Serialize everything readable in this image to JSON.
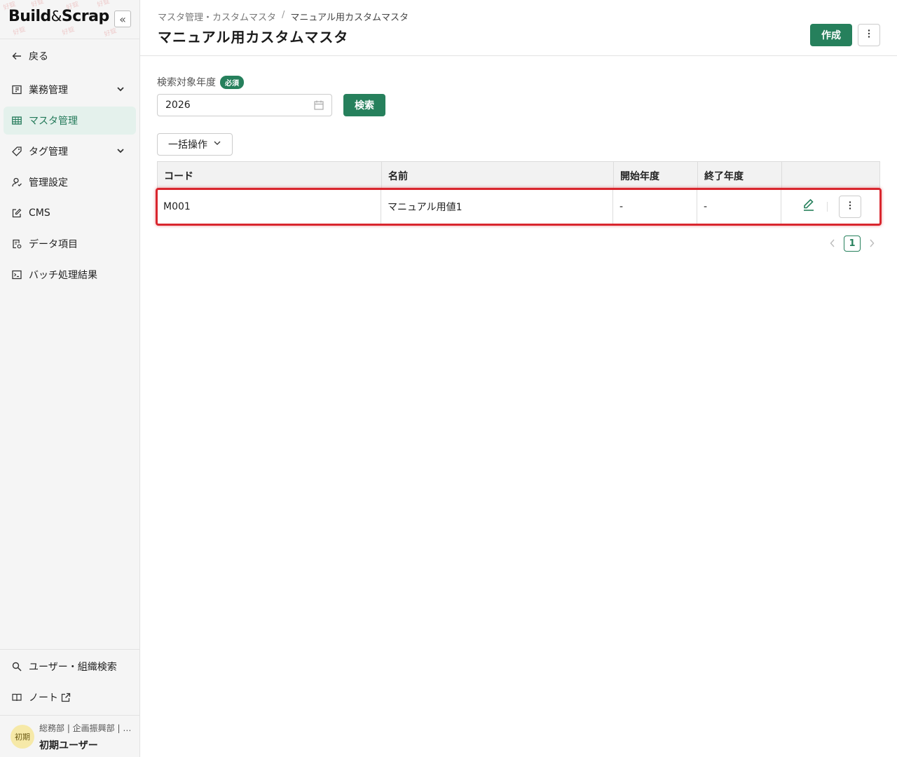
{
  "app": {
    "logo_part1": "Build",
    "logo_amp": "&",
    "logo_part2": "Scrap",
    "collapse_glyph": "«",
    "accent_color": "#26805c",
    "highlight_color": "#d9262e"
  },
  "sidebar": {
    "back_label": "戻る",
    "items": [
      {
        "label": "業務管理",
        "icon": "document-panel-icon",
        "expandable": true
      },
      {
        "label": "マスタ管理",
        "icon": "table-grid-icon",
        "active": true
      },
      {
        "label": "タグ管理",
        "icon": "tag-icon",
        "expandable": true
      },
      {
        "label": "管理設定",
        "icon": "user-settings-icon"
      },
      {
        "label": "CMS",
        "icon": "edit-square-icon"
      },
      {
        "label": "データ項目",
        "icon": "data-items-icon"
      },
      {
        "label": "バッチ処理結果",
        "icon": "terminal-icon"
      }
    ],
    "bottom_items": [
      {
        "label": "ユーザー・組織検索",
        "icon": "search-icon"
      },
      {
        "label": "ノート",
        "icon": "book-icon",
        "external": true
      }
    ],
    "user": {
      "avatar_text": "初期",
      "department": "総務部 | 企画振興部 | …",
      "name": "初期ユーザー"
    }
  },
  "header": {
    "breadcrumb": [
      "マスタ管理・カスタムマスタ",
      "マニュアル用カスタムマスタ"
    ],
    "breadcrumb_sep": "/",
    "title": "マニュアル用カスタムマスタ",
    "create_label": "作成"
  },
  "search": {
    "label": "検索対象年度",
    "required_badge": "必須",
    "year_value": "2026",
    "search_label": "検索"
  },
  "bulk_action_label": "一括操作",
  "table": {
    "columns": [
      "コード",
      "名前",
      "開始年度",
      "終了年度",
      ""
    ],
    "rows": [
      {
        "code": "M001",
        "name": "マニュアル用値1",
        "start_year": "-",
        "end_year": "-"
      }
    ]
  },
  "pagination": {
    "current_page": "1"
  }
}
